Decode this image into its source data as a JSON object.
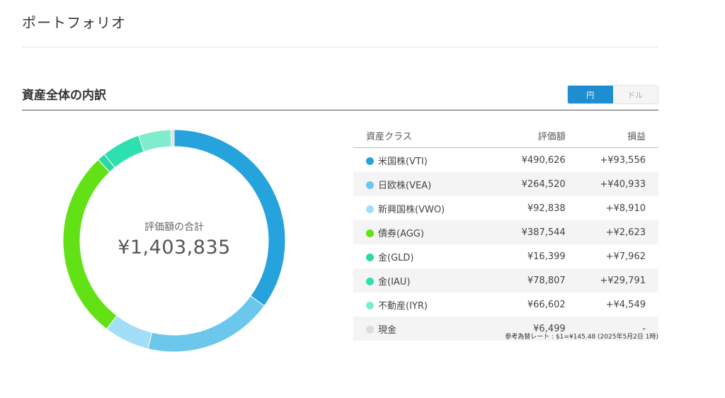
{
  "page": {
    "title": "ポートフォリオ",
    "section_title": "資産全体の内訳"
  },
  "currency_toggle": {
    "options": [
      "円",
      "ドル"
    ],
    "selected": "円"
  },
  "summary": {
    "total_label": "評価額の合計",
    "total_value": "¥1,403,835"
  },
  "table": {
    "headers": [
      "資産クラス",
      "評価額",
      "損益"
    ],
    "rows": [
      {
        "name": "米国株(VTI)",
        "value": "¥490,626",
        "gain": "+¥93,556",
        "color": "#26a3dd"
      },
      {
        "name": "日欧株(VEA)",
        "value": "¥264,520",
        "gain": "+¥40,933",
        "color": "#6cc7ec"
      },
      {
        "name": "新興国株(VWO)",
        "value": "¥92,838",
        "gain": "+¥8,910",
        "color": "#a3def9"
      },
      {
        "name": "債券(AGG)",
        "value": "¥387,544",
        "gain": "+¥2,623",
        "color": "#62e214"
      },
      {
        "name": "金(GLD)",
        "value": "¥16,399",
        "gain": "+¥7,962",
        "color": "#2bd9a6"
      },
      {
        "name": "金(IAU)",
        "value": "¥78,807",
        "gain": "+¥29,791",
        "color": "#2ee0b0"
      },
      {
        "name": "不動産(IYR)",
        "value": "¥66,602",
        "gain": "+¥4,549",
        "color": "#7feccd"
      },
      {
        "name": "現金",
        "value": "¥6,499",
        "gain": "-",
        "color": "#dcdcdc"
      }
    ]
  },
  "chart_data": {
    "type": "pie",
    "categories": [
      "米国株(VTI)",
      "日欧株(VEA)",
      "新興国株(VWO)",
      "債券(AGG)",
      "金(GLD)",
      "金(IAU)",
      "不動産(IYR)",
      "現金"
    ],
    "values": [
      490626,
      264520,
      92838,
      387544,
      16399,
      78807,
      66602,
      6499
    ],
    "colors": [
      "#26a3dd",
      "#6cc7ec",
      "#a3def9",
      "#62e214",
      "#2bd9a6",
      "#2ee0b0",
      "#7feccd",
      "#dcdcdc"
    ],
    "style": "donut"
  },
  "fx_note": "参考為替レート : $1=¥145.48 (2025年5月2日 1時)"
}
